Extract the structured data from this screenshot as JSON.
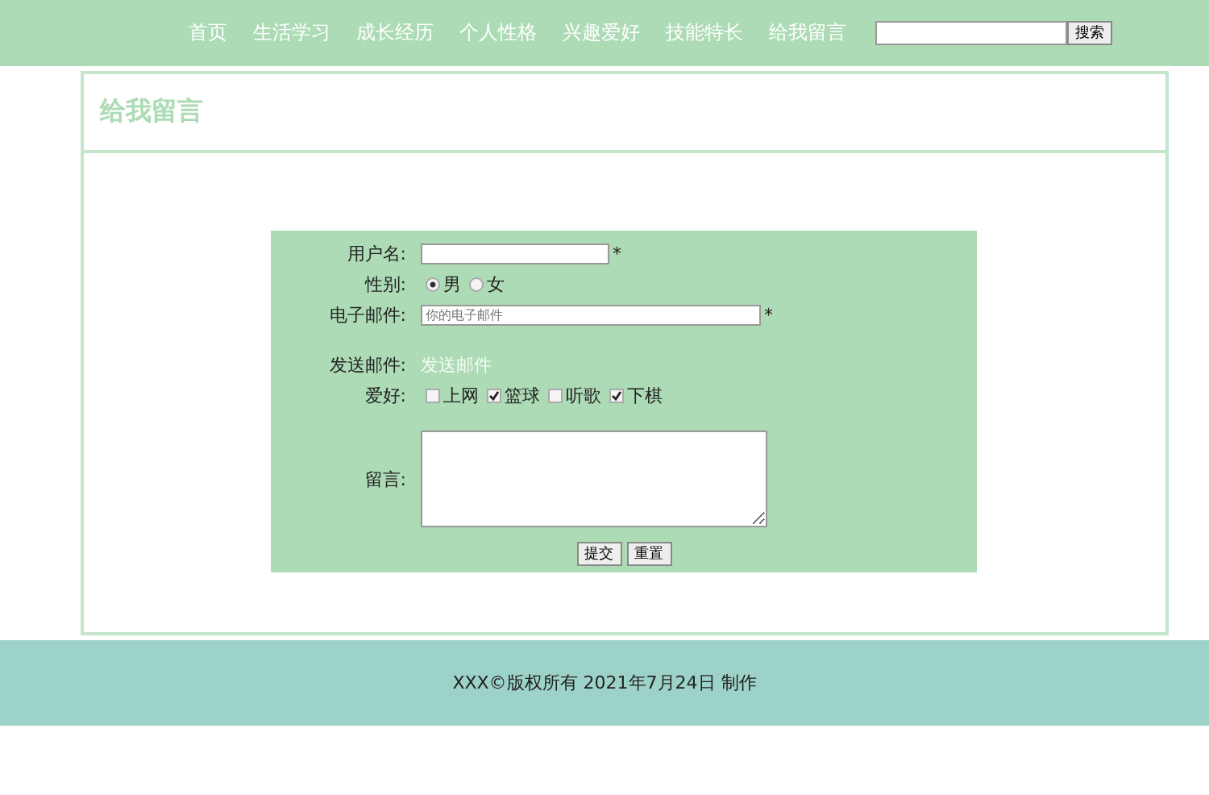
{
  "nav": {
    "items": [
      {
        "label": "首页"
      },
      {
        "label": "生活学习"
      },
      {
        "label": "成长经历"
      },
      {
        "label": "个人性格"
      },
      {
        "label": "兴趣爱好"
      },
      {
        "label": "技能特长"
      },
      {
        "label": "给我留言"
      }
    ],
    "search_button": "搜索"
  },
  "page_title": "给我留言",
  "form": {
    "rows": [
      {
        "kind": "text",
        "label": "用户名:",
        "required_mark": "*"
      },
      {
        "kind": "radio",
        "label": "性别:",
        "options": [
          {
            "label": "男",
            "selected": true
          },
          {
            "label": "女",
            "selected": false
          }
        ]
      },
      {
        "kind": "email",
        "label": "电子邮件:",
        "placeholder": "你的电子邮件",
        "required_mark": "*"
      },
      {
        "kind": "link",
        "label": "发送邮件:",
        "link": "发送邮件"
      },
      {
        "kind": "checkbox",
        "label": "爱好:",
        "options": [
          {
            "label": "上网",
            "checked": false
          },
          {
            "label": "篮球",
            "checked": true
          },
          {
            "label": "听歌",
            "checked": false
          },
          {
            "label": "下棋",
            "checked": true
          }
        ]
      },
      {
        "kind": "textarea",
        "label": "留言:"
      }
    ],
    "buttons": [
      "提交",
      "重置"
    ]
  },
  "footer": "XXX©版权所有 2021年7月24日 制作"
}
